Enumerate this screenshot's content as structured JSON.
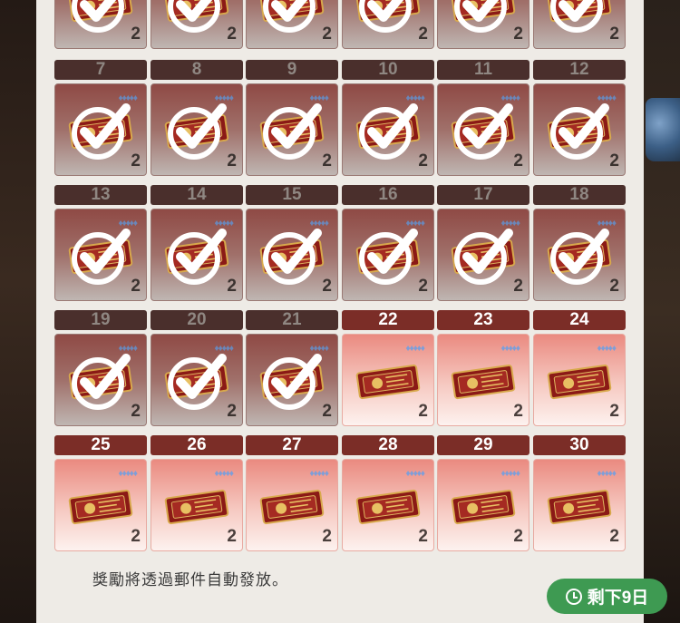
{
  "top_row": {
    "days": [
      {
        "amount": "2",
        "status": "claimed"
      },
      {
        "amount": "2",
        "status": "claimed"
      },
      {
        "amount": "2",
        "status": "claimed"
      },
      {
        "amount": "2",
        "status": "claimed"
      },
      {
        "amount": "2",
        "status": "claimed"
      },
      {
        "amount": "2",
        "status": "claimed"
      }
    ]
  },
  "rows": [
    [
      {
        "day": "7",
        "amount": "2",
        "status": "claimed"
      },
      {
        "day": "8",
        "amount": "2",
        "status": "claimed"
      },
      {
        "day": "9",
        "amount": "2",
        "status": "claimed"
      },
      {
        "day": "10",
        "amount": "2",
        "status": "claimed"
      },
      {
        "day": "11",
        "amount": "2",
        "status": "claimed"
      },
      {
        "day": "12",
        "amount": "2",
        "status": "claimed"
      }
    ],
    [
      {
        "day": "13",
        "amount": "2",
        "status": "claimed"
      },
      {
        "day": "14",
        "amount": "2",
        "status": "claimed"
      },
      {
        "day": "15",
        "amount": "2",
        "status": "claimed"
      },
      {
        "day": "16",
        "amount": "2",
        "status": "claimed"
      },
      {
        "day": "17",
        "amount": "2",
        "status": "claimed"
      },
      {
        "day": "18",
        "amount": "2",
        "status": "claimed"
      }
    ],
    [
      {
        "day": "19",
        "amount": "2",
        "status": "claimed"
      },
      {
        "day": "20",
        "amount": "2",
        "status": "claimed"
      },
      {
        "day": "21",
        "amount": "2",
        "status": "claimed"
      },
      {
        "day": "22",
        "amount": "2",
        "status": "pending"
      },
      {
        "day": "23",
        "amount": "2",
        "status": "pending"
      },
      {
        "day": "24",
        "amount": "2",
        "status": "pending"
      }
    ],
    [
      {
        "day": "25",
        "amount": "2",
        "status": "pending"
      },
      {
        "day": "26",
        "amount": "2",
        "status": "pending"
      },
      {
        "day": "27",
        "amount": "2",
        "status": "pending"
      },
      {
        "day": "28",
        "amount": "2",
        "status": "pending"
      },
      {
        "day": "29",
        "amount": "2",
        "status": "pending"
      },
      {
        "day": "30",
        "amount": "2",
        "status": "pending"
      }
    ]
  ],
  "gem_icon_text": "♦♦♦♦♦",
  "footer": {
    "note": "獎勵將透過郵件自動發放。",
    "remaining_label": "剩下9日"
  },
  "colors": {
    "claimed_header": "#4a2f2c",
    "pending_header": "#7b2d27",
    "remaining_badge": "#3e9a52"
  }
}
